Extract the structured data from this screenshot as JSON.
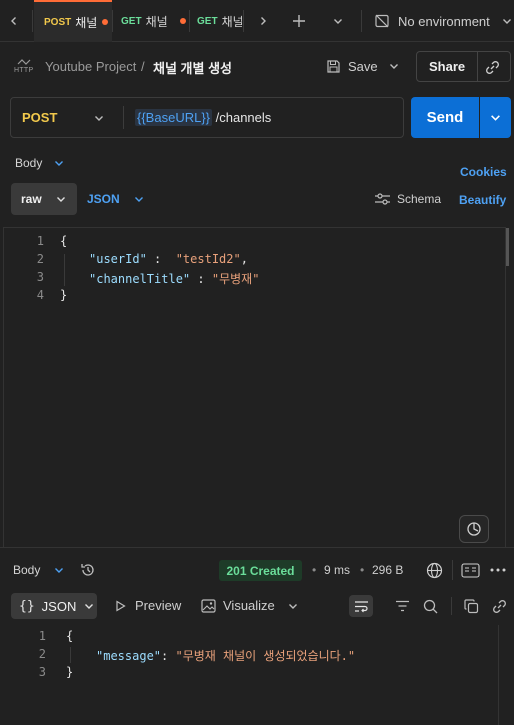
{
  "tabs": [
    {
      "method": "POST",
      "name": "채널"
    },
    {
      "method": "GET",
      "name": "채널"
    },
    {
      "method": "GET",
      "name": "채널"
    }
  ],
  "environment": {
    "label": "No environment"
  },
  "breadcrumb": {
    "badge": "HTTP",
    "collection": "Youtube Project",
    "separator": "/",
    "request": "채널 개별 생성"
  },
  "actions": {
    "save": "Save",
    "share": "Share"
  },
  "request": {
    "method": "POST",
    "url_variable": "{{BaseURL}}",
    "url_path": " /channels",
    "send": "Send"
  },
  "body_section": {
    "label": "Body",
    "cookies": "Cookies",
    "mode": "raw",
    "format": "JSON",
    "schema": "Schema",
    "beautify": "Beautify"
  },
  "request_body": {
    "line_numbers": [
      "1",
      "2",
      "3",
      "4"
    ],
    "open_brace": "{",
    "key1": "\"userId\"",
    "colon1": " :  ",
    "val1": "\"testId2\"",
    "comma1": ",",
    "key2": "\"channelTitle\"",
    "colon2": " : ",
    "val2": "\"무병재\"",
    "close_brace": "}"
  },
  "response": {
    "label": "Body",
    "status": "201 Created",
    "time": "9 ms",
    "size": "296 B",
    "format": "JSON",
    "preview": "Preview",
    "visualize": "Visualize",
    "line_numbers": [
      "1",
      "2",
      "3"
    ],
    "open_brace": "{",
    "key": "\"message\"",
    "colon": ": ",
    "value": "\"무병재 채널이 생성되었습니다.\"",
    "close_brace": "}"
  },
  "colors": {
    "accent": "#0c6fd6",
    "post": "#f2c94c",
    "get": "#6bdd9a",
    "status_ok": "#1f4d2f",
    "link": "#4ea1f3"
  }
}
